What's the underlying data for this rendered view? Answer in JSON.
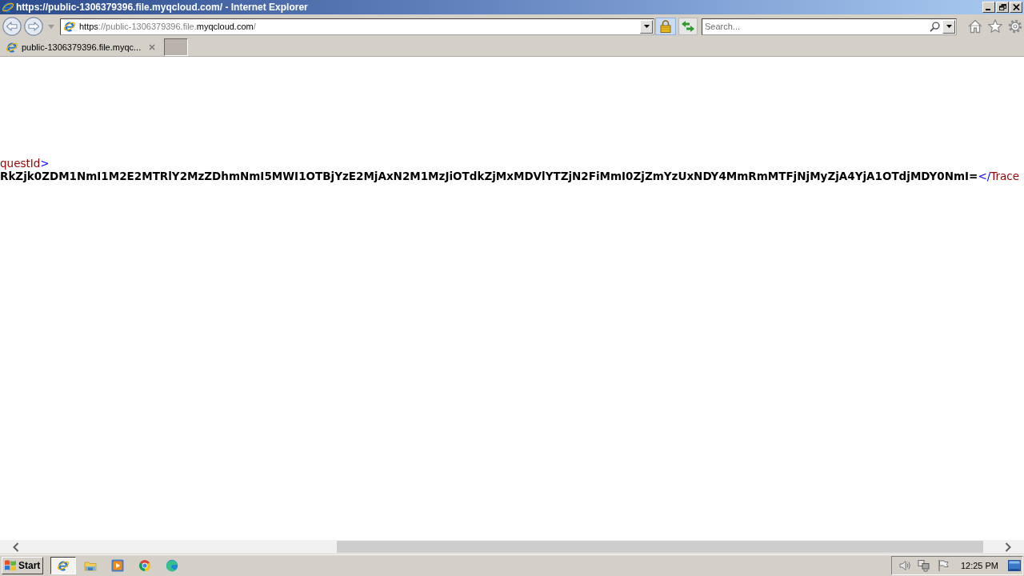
{
  "window": {
    "title": "https://public-1306379396.file.myqcloud.com/ - Internet Explorer"
  },
  "address_bar": {
    "url": [
      {
        "text": "https",
        "emphasis": true
      },
      {
        "text": "://public-1306379396.file.",
        "emphasis": false
      },
      {
        "text": "myqcloud.com",
        "emphasis": true
      },
      {
        "text": "/",
        "emphasis": false
      }
    ]
  },
  "search": {
    "placeholder": "Search..."
  },
  "tabs": [
    {
      "label": "public-1306379396.file.myqc...",
      "selected": true
    }
  ],
  "document": {
    "lines": [
      [
        {
          "text": "questId",
          "kind": "name"
        },
        {
          "text": ">",
          "kind": "markup"
        }
      ],
      [
        {
          "text": "RkZjk0ZDM1NmI1M2E2MTRlY2MzZDhmNmI5MWI1OTBjYzE2MjAxN2M1MzJiOTdkZjMxMDVlYTZjN2FiMmI0ZjZmYzUxNDY4MmRmMTFjNjMyZjA4YjA1OTdjMDY0NmI=",
          "kind": "value"
        },
        {
          "text": "</",
          "kind": "markup"
        },
        {
          "text": "Trace",
          "kind": "name"
        }
      ]
    ]
  },
  "taskbar": {
    "start": "Start",
    "buttons": [
      {
        "selected": true
      },
      {
        "selected": false
      },
      {
        "selected": false
      },
      {
        "selected": false
      },
      {
        "selected": false
      }
    ],
    "clock": "12:25 PM"
  }
}
